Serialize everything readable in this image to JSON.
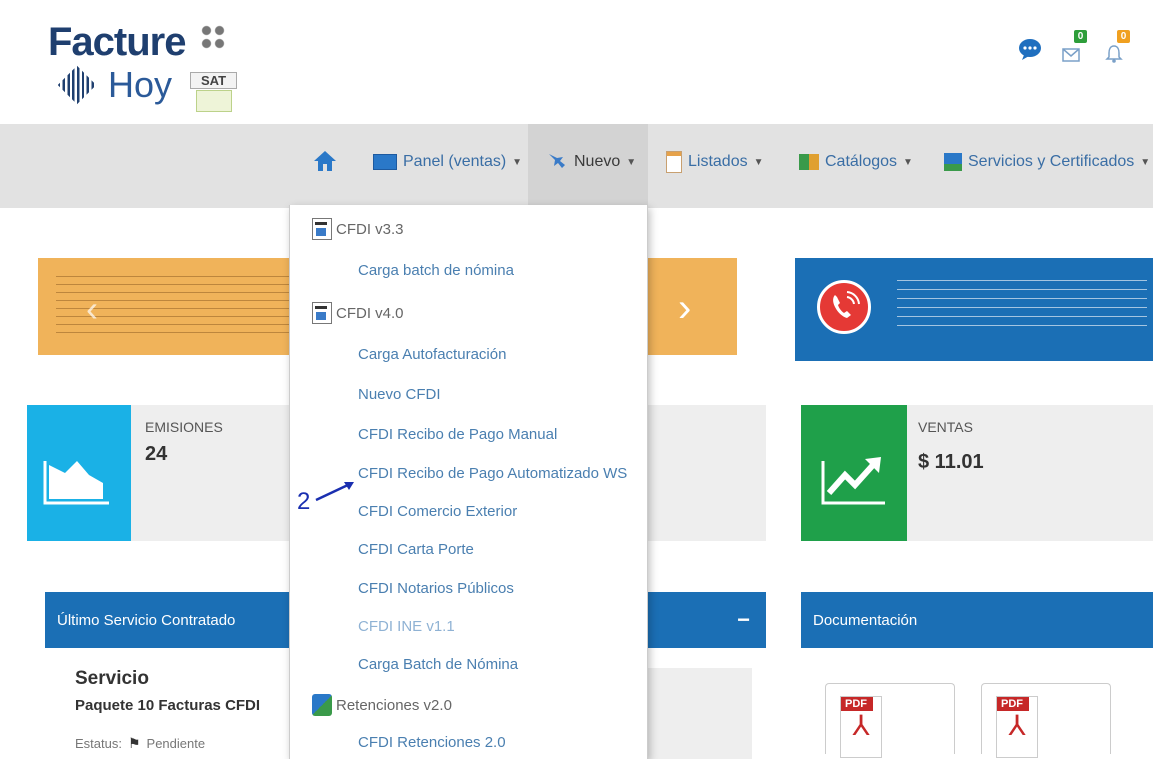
{
  "header": {
    "logo_line1": "Facture",
    "logo_line2": "Hoy",
    "sat_label": "SAT",
    "notif_messages_icon": "chat-bubble-icon",
    "notif_mail_count": "0",
    "notif_bell_count": "0"
  },
  "nav": {
    "home_icon": "home-icon",
    "items": [
      {
        "label": "Panel (ventas)"
      },
      {
        "label": "Nuevo"
      },
      {
        "label": "Listados"
      },
      {
        "label": "Catálogos"
      },
      {
        "label": "Servicios y Certificados"
      }
    ]
  },
  "dropdown": {
    "section1": "CFDI v3.3",
    "s1_items": [
      "Carga batch de nómina"
    ],
    "section2": "CFDI v4.0",
    "s2_items": [
      "Carga Autofacturación",
      "Nuevo CFDI",
      "CFDI Recibo de Pago Manual",
      "CFDI Recibo de Pago Automatizado WS",
      "CFDI Comercio Exterior",
      "CFDI Carta Porte",
      "CFDI Notarios Públicos",
      "CFDI INE v1.1",
      "Carga Batch de Nómina"
    ],
    "section3": "Retenciones v2.0",
    "s3_items": [
      "CFDI Retenciones 2.0"
    ]
  },
  "annotation": {
    "number": "2"
  },
  "stats": {
    "emisiones_label": "EMISIONES",
    "emisiones_value": "24",
    "ventas_label": "VENTAS",
    "ventas_value": "$ 11.01"
  },
  "panels": {
    "ultimo_title": "Último Servicio Contratado",
    "servicio_heading": "Servicio",
    "servicio_name": "Paquete 10 Facturas CFDI",
    "estatus_label": "Estatus:",
    "estatus_value": "Pendiente",
    "middle_collapse": "−",
    "documentacion_title": "Documentación",
    "pdf_label_1": "PDF",
    "pdf_label_2": "PDF"
  },
  "colors": {
    "navbar": "#e2e2e2",
    "link": "#3a6ea5",
    "panel_blue": "#1b6fb5",
    "emisiones_tile": "#1ab1e6",
    "ventas_tile": "#1fa04a",
    "banner_orange": "#f0b35a"
  }
}
